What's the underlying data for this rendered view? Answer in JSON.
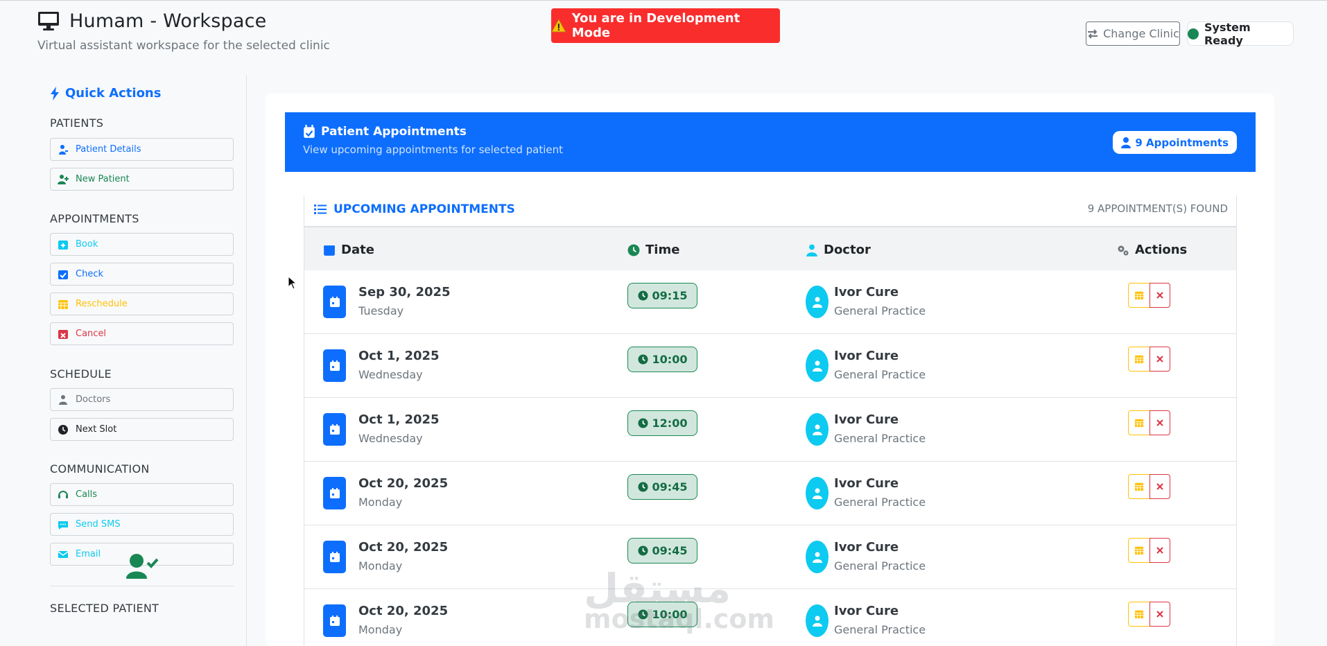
{
  "header": {
    "title": "Humam - Workspace",
    "subtitle": "Virtual assistant workspace for the selected clinic",
    "dev_banner": "You are in Development Mode",
    "change_clinic": "Change Clinic",
    "system_status": "System Ready"
  },
  "sidebar": {
    "title": "Quick Actions",
    "sections": {
      "patients": "PATIENTS",
      "appointments": "APPOINTMENTS",
      "schedule": "SCHEDULE",
      "communication": "COMMUNICATION",
      "selected_patient": "SELECTED PATIENT"
    },
    "buttons": {
      "patient_details": "Patient Details",
      "new_patient": "New Patient",
      "book": "Book",
      "check": "Check",
      "reschedule": "Reschedule",
      "cancel": "Cancel",
      "doctors": "Doctors",
      "next_slot": "Next Slot",
      "calls": "Calls",
      "send_sms": "Send SMS",
      "email": "Email"
    }
  },
  "panel": {
    "title": "Patient Appointments",
    "subtitle": "View upcoming appointments for selected patient",
    "count_badge": "9 Appointments",
    "section_title": "UPCOMING APPOINTMENTS",
    "found_text": "9 APPOINTMENT(S) FOUND",
    "columns": {
      "date": "Date",
      "time": "Time",
      "doctor": "Doctor",
      "actions": "Actions"
    }
  },
  "appointments": [
    {
      "date": "Sep 30, 2025",
      "day": "Tuesday",
      "time": "09:15",
      "doctor": "Ivor Cure",
      "specialty": "General Practice"
    },
    {
      "date": "Oct 1, 2025",
      "day": "Wednesday",
      "time": "10:00",
      "doctor": "Ivor Cure",
      "specialty": "General Practice"
    },
    {
      "date": "Oct 1, 2025",
      "day": "Wednesday",
      "time": "12:00",
      "doctor": "Ivor Cure",
      "specialty": "General Practice"
    },
    {
      "date": "Oct 20, 2025",
      "day": "Monday",
      "time": "09:45",
      "doctor": "Ivor Cure",
      "specialty": "General Practice"
    },
    {
      "date": "Oct 20, 2025",
      "day": "Monday",
      "time": "09:45",
      "doctor": "Ivor Cure",
      "specialty": "General Practice"
    },
    {
      "date": "Oct 20, 2025",
      "day": "Monday",
      "time": "10:00",
      "doctor": "Ivor Cure",
      "specialty": "General Practice"
    }
  ],
  "watermark": {
    "arabic": "مستقل",
    "latin": "mostaql.com"
  },
  "colors": {
    "primary": "#0d6efd",
    "info": "#0dcaf0",
    "success": "#198754",
    "warning": "#ffc107",
    "danger": "#dc3545",
    "dev_red": "#fa2d2d"
  }
}
